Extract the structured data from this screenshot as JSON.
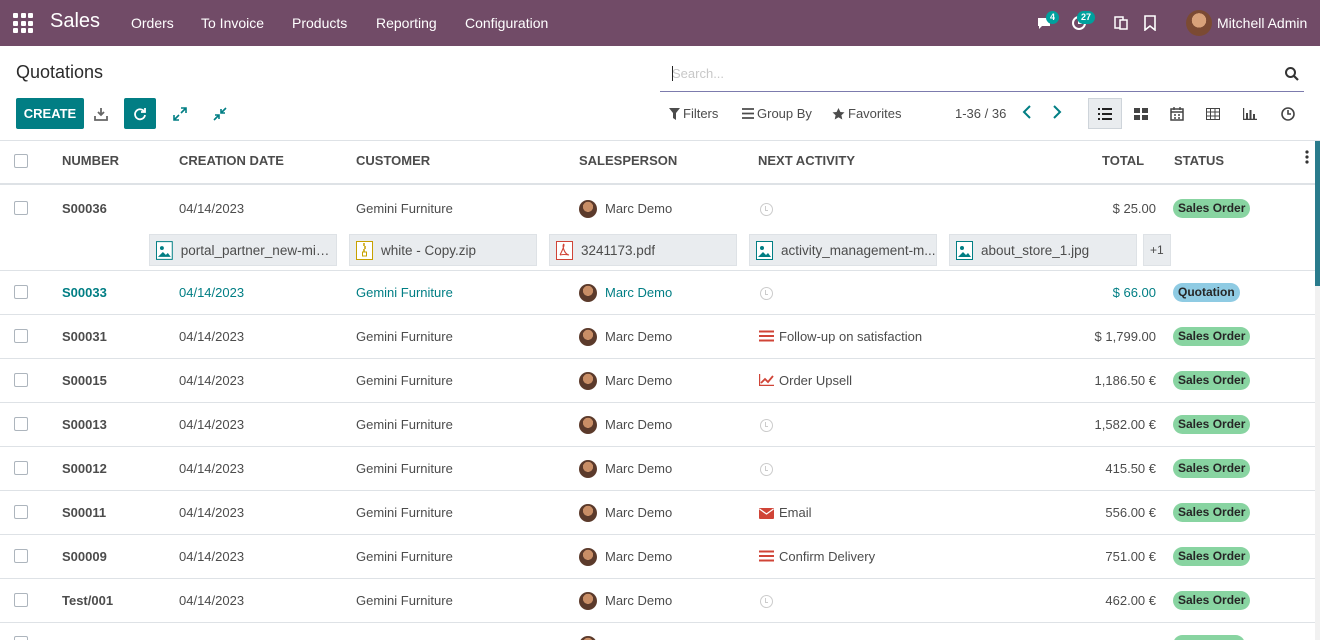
{
  "app": {
    "brand": "Sales",
    "menu": [
      "Orders",
      "To Invoice",
      "Products",
      "Reporting",
      "Configuration"
    ],
    "messages_count": "4",
    "activities_count": "27",
    "user_name": "Mitchell Admin"
  },
  "control_panel": {
    "title": "Quotations",
    "search_placeholder": "Search...",
    "create_label": "CREATE",
    "filters_label": "Filters",
    "groupby_label": "Group By",
    "favorites_label": "Favorites",
    "pager": "1-36 / 36"
  },
  "table": {
    "headers": {
      "number": "NUMBER",
      "creation_date": "CREATION DATE",
      "customer": "CUSTOMER",
      "salesperson": "SALESPERSON",
      "next_activity": "NEXT ACTIVITY",
      "total": "TOTAL",
      "status": "STATUS"
    },
    "rows": [
      {
        "number": "S00036",
        "date": "04/14/2023",
        "customer": "Gemini Furniture",
        "salesperson": "Marc Demo",
        "activity": "",
        "activity_icon": "clock-icon",
        "total": "$ 25.00",
        "status": "Sales Order"
      },
      {
        "number": "S00033",
        "date": "04/14/2023",
        "customer": "Gemini Furniture",
        "salesperson": "Marc Demo",
        "activity": "",
        "activity_icon": "clock-icon",
        "total": "$ 66.00",
        "status": "Quotation"
      },
      {
        "number": "S00031",
        "date": "04/14/2023",
        "customer": "Gemini Furniture",
        "salesperson": "Marc Demo",
        "activity": "Follow-up on satisfaction",
        "activity_icon": "list-icon",
        "total": "$ 1,799.00",
        "status": "Sales Order"
      },
      {
        "number": "S00015",
        "date": "04/14/2023",
        "customer": "Gemini Furniture",
        "salesperson": "Marc Demo",
        "activity": "Order Upsell",
        "activity_icon": "chart-line-icon",
        "total": "1,186.50 €",
        "status": "Sales Order"
      },
      {
        "number": "S00013",
        "date": "04/14/2023",
        "customer": "Gemini Furniture",
        "salesperson": "Marc Demo",
        "activity": "",
        "activity_icon": "clock-icon",
        "total": "1,582.00 €",
        "status": "Sales Order"
      },
      {
        "number": "S00012",
        "date": "04/14/2023",
        "customer": "Gemini Furniture",
        "salesperson": "Marc Demo",
        "activity": "",
        "activity_icon": "clock-icon",
        "total": "415.50 €",
        "status": "Sales Order"
      },
      {
        "number": "S00011",
        "date": "04/14/2023",
        "customer": "Gemini Furniture",
        "salesperson": "Marc Demo",
        "activity": "Email",
        "activity_icon": "envelope-icon",
        "total": "556.00 €",
        "status": "Sales Order"
      },
      {
        "number": "S00009",
        "date": "04/14/2023",
        "customer": "Gemini Furniture",
        "salesperson": "Marc Demo",
        "activity": "Confirm Delivery",
        "activity_icon": "list-icon",
        "total": "751.00 €",
        "status": "Sales Order"
      },
      {
        "number": "Test/001",
        "date": "04/14/2023",
        "customer": "Gemini Furniture",
        "salesperson": "Marc Demo",
        "activity": "",
        "activity_icon": "clock-icon",
        "total": "462.00 €",
        "status": "Sales Order"
      }
    ],
    "attachments": [
      {
        "name": "portal_partner_new-min....",
        "icon": "image-file-icon"
      },
      {
        "name": "white - Copy.zip",
        "icon": "zip-file-icon"
      },
      {
        "name": "3241173.pdf",
        "icon": "pdf-file-icon"
      },
      {
        "name": "activity_management-m...",
        "icon": "image-file-icon"
      },
      {
        "name": "about_store_1.jpg",
        "icon": "image-file-icon"
      }
    ],
    "attachments_more": "+1"
  },
  "colors": {
    "navbar": "#714b67",
    "primary": "#017e84",
    "sales_order_badge": "#88d4a1",
    "quotation_badge": "#8fcbe3",
    "activity_red": "#d04437"
  }
}
